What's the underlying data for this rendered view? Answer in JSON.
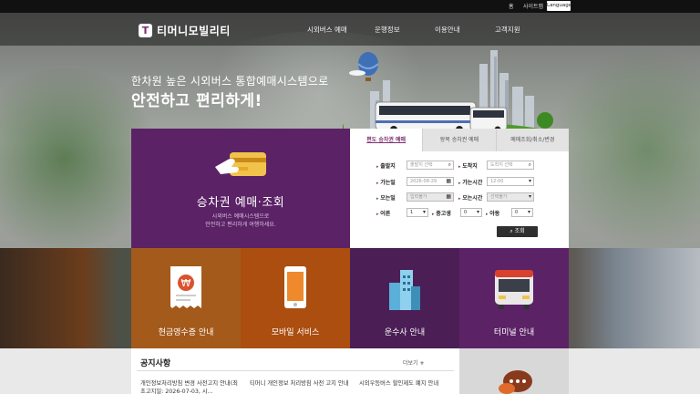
{
  "utility": {
    "home": "홈",
    "sitemap": "사이트맵",
    "language": "Language"
  },
  "header": {
    "logo_mark": "T",
    "logo_text": "티머니모빌리티",
    "menu": [
      "시외버스 예매",
      "운행정보",
      "이용안내",
      "고객지원"
    ]
  },
  "hero": {
    "slogan_line1": "한차원 높은 시외버스 통합예매시스템으로",
    "slogan_line2": "안전하고 편리하게!"
  },
  "booking": {
    "title": "승차권 예매·조회",
    "desc_line1": "시외버스 예매시스템으로",
    "desc_line2": "안전하고 편리하게 여행하세요.",
    "tabs": [
      "편도 승차권 예매",
      "왕복 승차권 예매",
      "예매조회/취소/변경"
    ],
    "labels": {
      "depart": "출발지",
      "arrive": "도착지",
      "go_date": "가는일",
      "go_time": "가는시간",
      "return_date": "오는일",
      "return_time": "오는시간",
      "adult": "어른",
      "teen": "중고생",
      "child": "아동"
    },
    "fields": {
      "depart_placeholder": "출발지 선택",
      "arrive_placeholder": "도착지 선택",
      "go_date": "2026-08-29",
      "go_time": "12:00",
      "return_date": "입력불가",
      "return_time": "선택불가",
      "adult": "1",
      "teen": "0",
      "child": "0"
    },
    "search_label": "조회",
    "accent_color": "#5b2266"
  },
  "tiles": [
    {
      "label": "현금영수증 안내",
      "color": "#a45a1b",
      "icon": "receipt-icon"
    },
    {
      "label": "모바일 서비스",
      "color": "#ab4e10",
      "icon": "mobile-icon"
    },
    {
      "label": "운수사 안내",
      "color": "#4b1f55",
      "icon": "building-icon"
    },
    {
      "label": "터미널 안내",
      "color": "#5b2266",
      "icon": "bus-icon"
    }
  ],
  "notice": {
    "title": "공지사항",
    "more": "더보기",
    "items": [
      "개인정보처리방침 변경 사전고지 안내(최초고지일: 2026-07-03, 시...",
      "티머니 개인정보 처리방침 사전 고지 안내",
      "시외우등버스 할인제도 폐지 안내"
    ]
  }
}
